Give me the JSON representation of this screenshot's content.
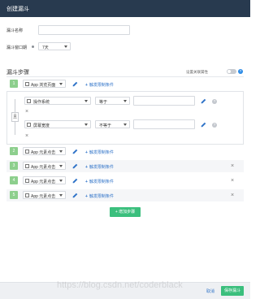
{
  "header": {
    "title": "创建漏斗"
  },
  "form": {
    "name_label": "漏斗名称",
    "name_value": "",
    "window_label": "漏斗窗口期",
    "window_value": "7天"
  },
  "steps_section": {
    "title": "漏斗步骤",
    "toggle_label": "设置关联属性",
    "toggle_on": false,
    "help_symbol": "?"
  },
  "steps": [
    {
      "index": "1",
      "event": "App 浏览页面",
      "add_filter": "触发限制条件",
      "removable": false
    },
    {
      "index": "2",
      "event": "App 元素点击",
      "add_filter": "触发限制条件",
      "removable": false
    },
    {
      "index": "3",
      "event": "App 元素点击",
      "add_filter": "触发限制条件",
      "removable": true
    },
    {
      "index": "4",
      "event": "App 元素点击",
      "add_filter": "触发限制条件",
      "removable": true
    },
    {
      "index": "5",
      "event": "App 元素点击",
      "add_filter": "触发限制条件",
      "removable": true
    }
  ],
  "conditions": {
    "logic_label": "且",
    "rows": [
      {
        "property": "操作系统",
        "operator": "等于",
        "value": ""
      },
      {
        "property": "屏幕宽度",
        "operator": "不等于",
        "value": ""
      }
    ],
    "help_symbol": "?"
  },
  "buttons": {
    "add_step": "增加步骤",
    "cancel": "取消",
    "save": "保存漏斗"
  },
  "watermark": "https://blog.csdn.net/coderblack",
  "colors": {
    "header_bg": "#283a4f",
    "accent_green": "#3bbf7d",
    "step_badge": "#8dcf8d",
    "link_blue": "#2f73c8"
  }
}
